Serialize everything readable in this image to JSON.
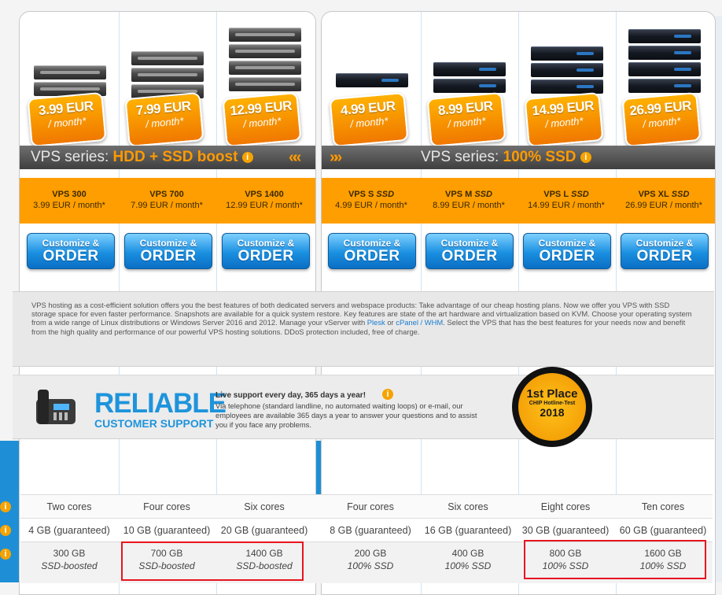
{
  "hdd": {
    "products": [
      {
        "price": "3.99 EUR",
        "per": "/ month*",
        "name": "VPS 300",
        "name_suffix": "",
        "sub": "3.99 EUR / month*"
      },
      {
        "price": "7.99 EUR",
        "per": "/ month*",
        "name": "VPS 700",
        "name_suffix": "",
        "sub": "7.99 EUR / month*"
      },
      {
        "price": "12.99 EUR",
        "per": "/ month*",
        "name": "VPS 1400",
        "name_suffix": "",
        "sub": "12.99 EUR / month*"
      }
    ],
    "series_prefix": "VPS series: ",
    "series_highlight": "HDD + SSD boost",
    "chevrons": "«"
  },
  "ssd": {
    "products": [
      {
        "price": "4.99 EUR",
        "per": "/ month*",
        "name": "VPS S",
        "name_suffix": "SSD",
        "sub": "4.99 EUR / month*"
      },
      {
        "price": "8.99 EUR",
        "per": "/ month*",
        "name": "VPS M",
        "name_suffix": "SSD",
        "sub": "8.99 EUR / month*"
      },
      {
        "price": "14.99 EUR",
        "per": "/ month*",
        "name": "VPS L",
        "name_suffix": "SSD",
        "sub": "14.99 EUR / month*"
      },
      {
        "price": "26.99 EUR",
        "per": "/ month*",
        "name": "VPS XL",
        "name_suffix": "SSD",
        "sub": "26.99 EUR / month*"
      }
    ],
    "series_prefix": "VPS series: ",
    "series_highlight": "100% SSD",
    "chevrons": "»"
  },
  "order_button": {
    "line1": "Customize &",
    "line2": "ORDER"
  },
  "info_glyph": "i",
  "description": {
    "p1": "VPS hosting as a cost-efficient solution offers you the best features of both dedicated servers and webspace products: Take advantage of our cheap hosting plans. Now we offer you VPS with SSD storage space for even faster performance. Snapshots are available for a quick system restore. Key features are state of the art hardware and virtualization based on KVM. Choose your operating system from a wide range of Linux distributions or Windows Server 2016 and 2012. Manage your vServer with ",
    "link1": "Plesk",
    "mid": " or ",
    "link2": "cPanel / WHM",
    "p2": ". Select the VPS that has the best features for your needs now and benefit from the high quality and performance of our powerful VPS hosting solutions. DDoS protection included, free of charge."
  },
  "support": {
    "title": "RELIABLE",
    "subtitle": "CUSTOMER SUPPORT",
    "heading": "Live support every day, 365 days a year!",
    "body": "Via telephone (standard landline, no automated waiting loops) or e-mail, our employees are available 365 days a year to answer your questions and to assist you if you face any problems."
  },
  "award": {
    "line1": "1st Place",
    "line2": "CHIP Hotline-Test",
    "line3": "2018"
  },
  "specs": {
    "cores": [
      "Two cores",
      "Four cores",
      "Six cores",
      "Four cores",
      "Six cores",
      "Eight cores",
      "Ten cores"
    ],
    "ram": [
      "4 GB (guaranteed)",
      "10 GB (guaranteed)",
      "20 GB (guaranteed)",
      "8 GB (guaranteed)",
      "16 GB (guaranteed)",
      "30 GB (guaranteed)",
      "60 GB (guaranteed)"
    ],
    "storage": [
      {
        "size": "300 GB",
        "type": "SSD-boosted"
      },
      {
        "size": "700 GB",
        "type": "SSD-boosted"
      },
      {
        "size": "1400 GB",
        "type": "SSD-boosted"
      },
      {
        "size": "200 GB",
        "type": "100% SSD"
      },
      {
        "size": "400 GB",
        "type": "100% SSD"
      },
      {
        "size": "800 GB",
        "type": "100% SSD"
      },
      {
        "size": "1600 GB",
        "type": "100% SSD"
      }
    ]
  },
  "colors": {
    "accent_orange": "#ff9e00",
    "accent_blue": "#1e94dc",
    "highlight_red": "#e8141e"
  }
}
